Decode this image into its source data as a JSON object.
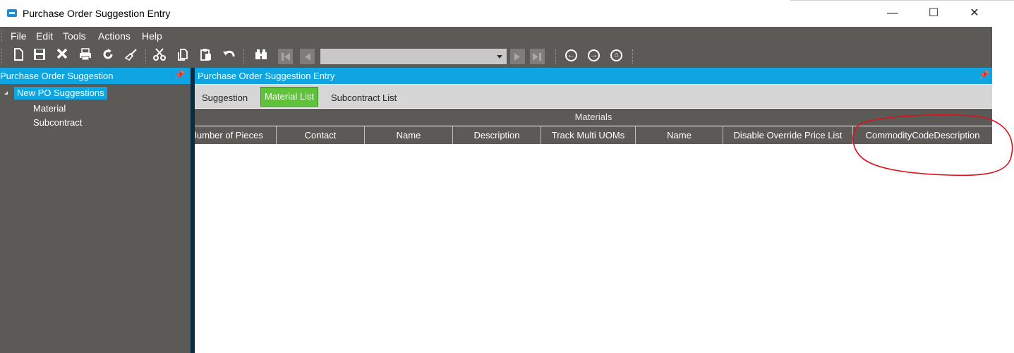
{
  "window": {
    "title": "Purchase Order Suggestion Entry",
    "minimize_glyph": "—",
    "maximize_glyph": "☐",
    "close_glyph": "✕"
  },
  "menu": [
    "File",
    "Edit",
    "Tools",
    "Actions",
    "Help"
  ],
  "toolbar": {
    "icons": [
      "new-icon",
      "save-icon",
      "delete-icon",
      "print-icon",
      "refresh-icon",
      "clear-icon",
      "cut-icon",
      "copy-icon",
      "paste-icon",
      "undo-icon",
      "find-icon",
      "first-record-icon",
      "previous-record-icon",
      "record-dropdown",
      "next-record-icon",
      "last-record-icon",
      "back-icon",
      "forward-icon",
      "home-icon"
    ],
    "record_value": ""
  },
  "tree_panel": {
    "title": "Purchase Order Suggestion",
    "pin_glyph": "ᵖ",
    "root": "New PO Suggestions",
    "children": [
      "Material",
      "Subcontract"
    ]
  },
  "main_panel": {
    "title": "Purchase Order Suggestion Entry",
    "tabs": [
      "Suggestion",
      "Material List",
      "Subcontract List"
    ],
    "active_tab": "Material List",
    "grid": {
      "group_header": "Materials",
      "columns": [
        "lumber of Pieces",
        "Contact",
        "Name",
        "Description",
        "Track Multi UOMs",
        "Name",
        "Disable Override Price List",
        "CommodityCodeDescription"
      ]
    }
  },
  "colors": {
    "chrome": "#5b5a57",
    "panel_header": "#0ea5e2",
    "active_tab": "#5ec338",
    "annotation": "#e0101a"
  }
}
